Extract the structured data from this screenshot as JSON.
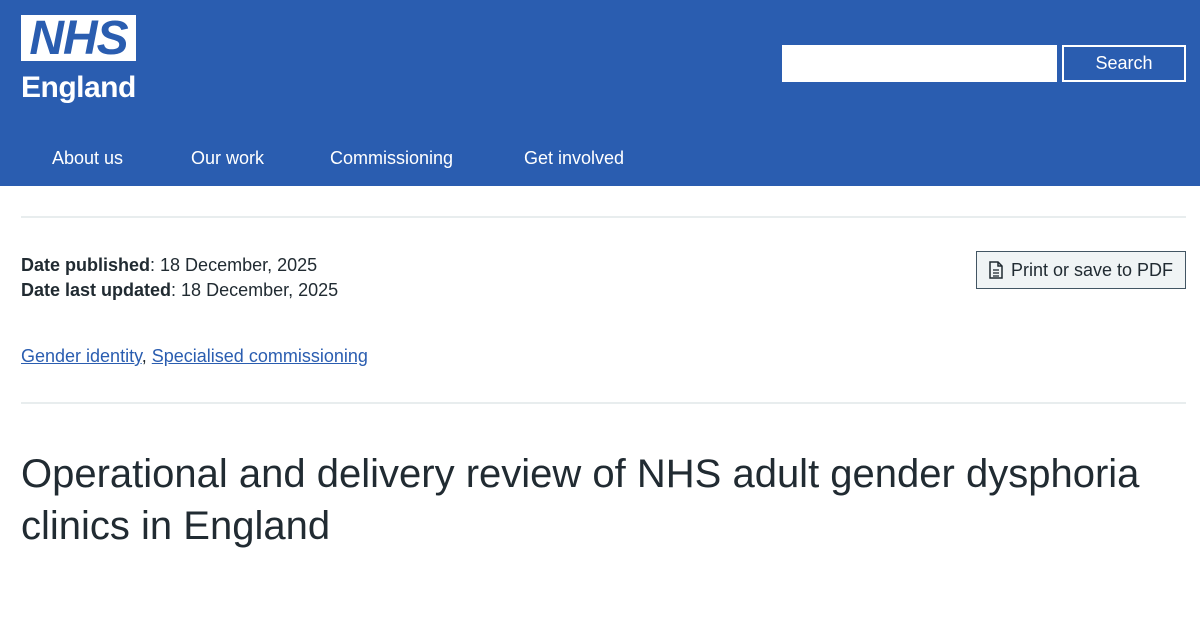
{
  "header": {
    "logo": {
      "nhs": "NHS",
      "region": "England"
    },
    "search": {
      "value": "",
      "button_label": "Search"
    },
    "nav": [
      {
        "label": "About us"
      },
      {
        "label": "Our work"
      },
      {
        "label": "Commissioning"
      },
      {
        "label": "Get involved"
      }
    ]
  },
  "meta": {
    "published_label": "Date published",
    "published_date": "18 December, 2025",
    "updated_label": "Date last updated",
    "updated_date": "18 December, 2025"
  },
  "pdf_button": {
    "label": "Print or save to PDF",
    "icon": "document-icon"
  },
  "tags": [
    {
      "label": "Gender identity"
    },
    {
      "label": "Specialised commissioning"
    }
  ],
  "page": {
    "title": "Operational and delivery review of NHS adult gender dysphoria clinics in England"
  },
  "colors": {
    "header_background": "#2a5db0",
    "link": "#2a5db0",
    "text": "#212b32",
    "divider": "#e8edee"
  }
}
